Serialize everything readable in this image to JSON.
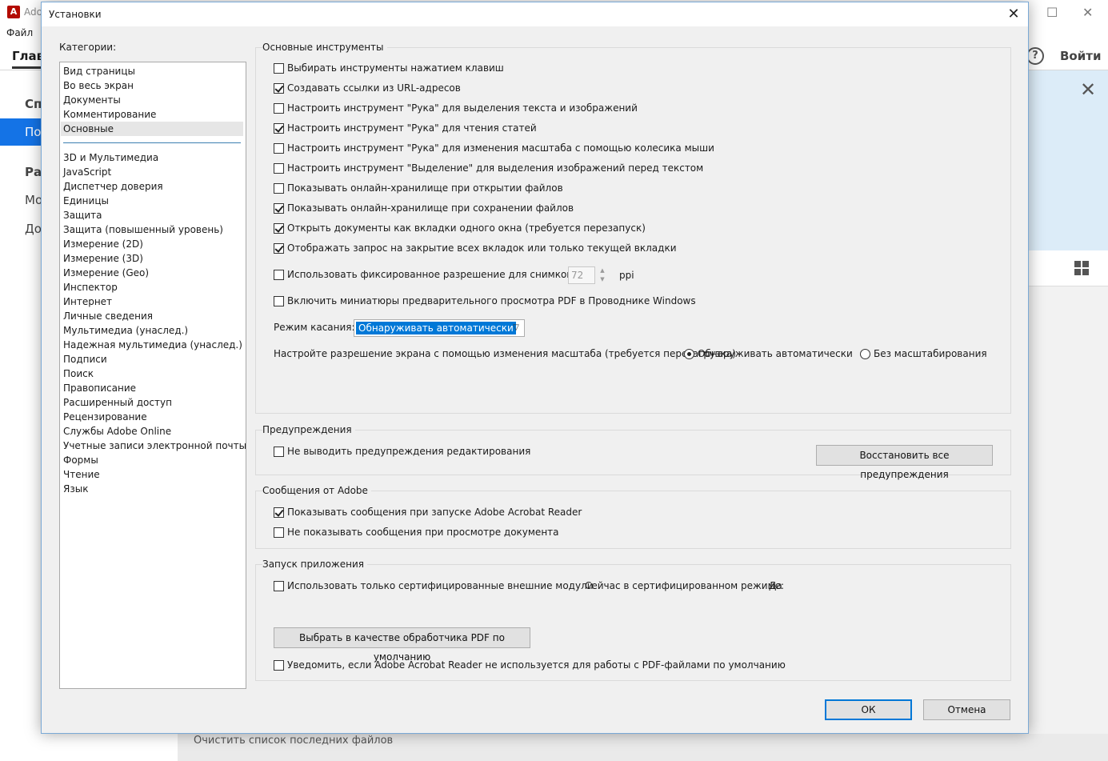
{
  "background": {
    "app_title": "Ado",
    "menu_file": "Файл",
    "home_tab": "Глав",
    "help_icon": "?",
    "sign_in": "Войти",
    "left_items": [
      "Сп",
      "По",
      "Ра",
      "Мо",
      "До"
    ],
    "clear_recent": "Очистить список последних файлов",
    "accent_color": "#1473e6"
  },
  "dialog": {
    "title": "Установки",
    "close_glyph": "✕",
    "categories_label": "Категории:",
    "categories_top": [
      "Вид страницы",
      "Во весь экран",
      "Документы",
      "Комментирование",
      "Основные"
    ],
    "selected_category": "Основные",
    "categories_rest": [
      "3D и Мультимедиа",
      "JavaScript",
      "Диспетчер доверия",
      "Единицы",
      "Защита",
      "Защита (повышенный уровень)",
      "Измерение (2D)",
      "Измерение (3D)",
      "Измерение (Geo)",
      "Инспектор",
      "Интернет",
      "Личные сведения",
      "Мультимедиа (унаслед.)",
      "Надежная мультимедиа (унаслед.)",
      "Подписи",
      "Поиск",
      "Правописание",
      "Расширенный доступ",
      "Рецензирование",
      "Службы Adobe Online",
      "Учетные записи электронной почты",
      "Формы",
      "Чтение",
      "Язык"
    ],
    "basic_tools": {
      "title": "Основные инструменты",
      "options": [
        {
          "label": "Выбирать инструменты нажатием клавиш",
          "checked": false
        },
        {
          "label": "Создавать ссылки из URL-адресов",
          "checked": true
        },
        {
          "label": "Настроить инструмент \"Рука\" для выделения текста и изображений",
          "checked": false
        },
        {
          "label": "Настроить инструмент \"Рука\" для чтения статей",
          "checked": true
        },
        {
          "label": "Настроить инструмент \"Рука\" для изменения масштаба с помощью колесика мыши",
          "checked": false
        },
        {
          "label": "Настроить инструмент \"Выделение\" для выделения изображений перед текстом",
          "checked": false
        },
        {
          "label": "Показывать онлайн-хранилище при открытии файлов",
          "checked": false
        },
        {
          "label": "Показывать онлайн-хранилище при сохранении файлов",
          "checked": true
        },
        {
          "label": "Открыть документы как вкладки одного окна (требуется перезапуск)",
          "checked": true
        },
        {
          "label": "Отображать запрос на закрытие всех вкладок или только текущей вкладки",
          "checked": true
        }
      ],
      "fixed_resolution": {
        "label": "Использовать фиксированное разрешение для снимков:",
        "checked": false,
        "value": "72",
        "unit": "ppi"
      },
      "thumbnails": {
        "label": "Включить миниатюры предварительного просмотра PDF в Проводнике Windows",
        "checked": false
      },
      "touch_mode_label": "Режим касания:",
      "touch_mode_value": "Обнаруживать автоматически",
      "scaling_label": "Настройте разрешение экрана с помощью изменения масштаба (требуется перезагрузка)",
      "scaling_auto": {
        "label": "Обнаруживать автоматически",
        "checked": true
      },
      "scaling_none": {
        "label": "Без масштабирования",
        "checked": false
      }
    },
    "warnings": {
      "title": "Предупреждения",
      "no_edit_warnings": {
        "label": "Не выводить предупреждения редактирования",
        "checked": false
      },
      "reset_button": "Восстановить все предупреждения"
    },
    "messages": {
      "title": "Сообщения от Adobe",
      "show_on_launch": {
        "label": "Показывать сообщения при запуске Adobe Acrobat Reader",
        "checked": true
      },
      "hide_on_view": {
        "label": "Не показывать сообщения при просмотре документа",
        "checked": false
      }
    },
    "startup": {
      "title": "Запуск приложения",
      "certified_only": {
        "label": "Использовать только сертифицированные внешние модули",
        "checked": false
      },
      "certified_mode_label": "Сейчас в сертифицированном режиме:",
      "certified_mode_value": "Да",
      "default_handler_button": "Выбрать в качестве обработчика PDF по умолчанию",
      "notify_default": {
        "label": "Уведомить, если Adobe Acrobat Reader не используется для работы с PDF-файлами по умолчанию",
        "checked": false
      }
    },
    "ok_button": "ОК",
    "cancel_button": "Отмена"
  }
}
